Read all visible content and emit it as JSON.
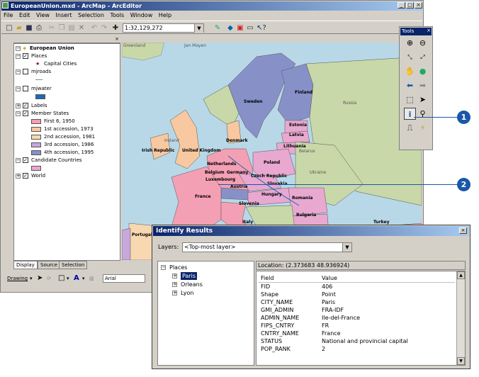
{
  "window": {
    "title": "EuropeanUnion.mxd - ArcMap - ArcEditor",
    "min": "_",
    "max": "□",
    "close": "×"
  },
  "menu": [
    "File",
    "Edit",
    "View",
    "Insert",
    "Selection",
    "Tools",
    "Window",
    "Help"
  ],
  "toolbar": {
    "scale": "1:32,129,272"
  },
  "toc": {
    "root": "European Union",
    "items": [
      {
        "label": "Places"
      },
      {
        "label": "Capital Cities"
      },
      {
        "label": "mjroads"
      },
      {
        "label": "mjwater"
      },
      {
        "label": "Labels"
      },
      {
        "label": "Member States"
      },
      {
        "label": "First 6, 1950"
      },
      {
        "label": "1st accession, 1973"
      },
      {
        "label": "2nd accession, 1981"
      },
      {
        "label": "3rd accession, 1986"
      },
      {
        "label": "4th accession, 1995"
      },
      {
        "label": "Candidate Countries"
      },
      {
        "label": "World"
      }
    ],
    "tabs": [
      "Display",
      "Source",
      "Selection"
    ]
  },
  "colors": {
    "first6": "#f4a0b4",
    "first_acc": "#f8c8a0",
    "second_acc": "#f8d8b0",
    "third_acc": "#c8a8d8",
    "fourth_acc": "#8890c8",
    "candidate": "#e8a8d0",
    "water": "#1a6ab8",
    "land": "#c8d8a8",
    "sea": "#b8d8e8"
  },
  "drawing": {
    "label": "Drawing",
    "font": "Arial"
  },
  "tools": {
    "title": "Tools"
  },
  "map_labels": [
    "Greenland",
    "Jan Mayen",
    "Sweden",
    "Finland",
    "Russia",
    "Estonia",
    "Latvia",
    "Lithuania",
    "Denmark",
    "Belarus",
    "Ireland",
    "Irish Republic",
    "United Kingdom",
    "Netherlands",
    "Belgium",
    "Germany",
    "Luxembourg",
    "Poland",
    "Czech Republic",
    "Slovakia",
    "Ukraine",
    "Austria",
    "Hungary",
    "France",
    "Romania",
    "Slovenia",
    "Bulgaria",
    "Italy",
    "Portugal",
    "Turkey"
  ],
  "callouts": [
    "1",
    "2"
  ],
  "identify": {
    "title": "Identify Results",
    "layers_label": "Layers:",
    "layers_value": "<Top-most layer>",
    "tree_root": "Places",
    "tree_items": [
      "Paris",
      "Orleans",
      "Lyon"
    ],
    "location": "Location: (2.373683 48.936924)",
    "headers": [
      "Field",
      "Value"
    ],
    "rows": [
      [
        "FID",
        "406"
      ],
      [
        "Shape",
        "Point"
      ],
      [
        "CITY_NAME",
        "Paris"
      ],
      [
        "GMI_ADMIN",
        "FRA-IDF"
      ],
      [
        "ADMIN_NAME",
        "Ile-del-France"
      ],
      [
        "FIPS_CNTRY",
        "FR"
      ],
      [
        "CNTRY_NAME",
        "France"
      ],
      [
        "STATUS",
        "National and provincial capital"
      ],
      [
        "POP_RANK",
        "2"
      ]
    ]
  }
}
